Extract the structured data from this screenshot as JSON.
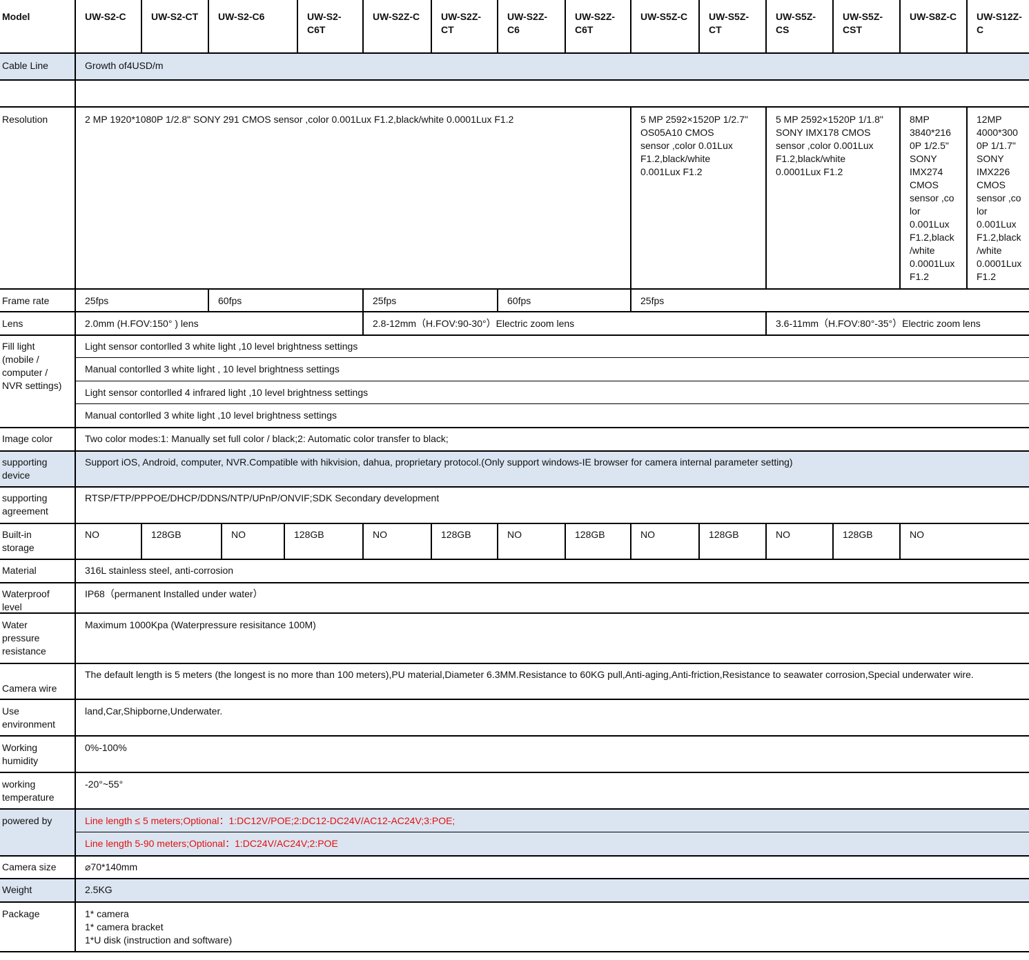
{
  "table": {
    "headers": [
      "Model",
      "UW-S2-C",
      "UW-S2-CT",
      "UW-S2-C6",
      "UW-S2-\nC6T",
      "UW-S2Z-C",
      "UW-S2Z-\nCT",
      "UW-S2Z-\nC6",
      "UW-S2Z-\nC6T",
      "UW-S5Z-C",
      "UW-S5Z-\nCT",
      "UW-S5Z-\nCS",
      "UW-S5Z-\nCST",
      "UW-S8Z-C",
      "UW-S12Z-\nC"
    ],
    "cable_line": {
      "label": "Cable Line",
      "value": "Growth of4USD/m"
    },
    "resolution": {
      "label": "Resolution",
      "s2": "2 MP 1920*1080P 1/2.8\" SONY 291 CMOS sensor ,color 0.001Lux F1.2,black/white 0.0001Lux F1.2",
      "s5_os": "5 MP 2592×1520P 1/2.7\"\nOS05A10 CMOS\nsensor ,color 0.01Lux\nF1.2,black/white\n0.001Lux F1.2",
      "s5_sony": "5 MP 2592×1520P 1/1.8\"\nSONY IMX178 CMOS\nsensor ,color 0.001Lux\nF1.2,black/white\n0.0001Lux F1.2",
      "s8": "8MP\n3840*216\n0P 1/2.5\"\nSONY\nIMX274\nCMOS\nsensor ,co\nlor\n0.001Lux\nF1.2,black\n/white\n0.0001Lux\nF1.2",
      "s12": "12MP\n4000*300\n0P  1/1.7\"\nSONY\nIMX226\nCMOS\nsensor ,co\nlor\n0.001Lux\nF1.2,black\n/white\n0.0001Lux\nF1.2"
    },
    "frame_rate": {
      "label": "Frame rate",
      "values": [
        "25fps",
        "60fps",
        "25fps",
        "60fps",
        "25fps"
      ]
    },
    "lens": {
      "label": "Lens",
      "values": [
        "2.0mm (H.FOV:150° ) lens",
        "2.8-12mm（H.FOV:90-30°）Electric zoom lens",
        "3.6-11mm（H.FOV:80°-35°）Electric zoom lens"
      ]
    },
    "fill_light": {
      "label": "Fill light\n(mobile /\ncomputer /\nNVR settings)",
      "values": [
        "Light  sensor contorlled  3 white light ,10 level brightness settings",
        "Manual contorlled 3 white light , 10 level brightness settings",
        "Light  sensor contorlled 4 infrared light ,10 level brightness  settings",
        "Manual contorlled 3 white light ,10 level  brightness settings"
      ]
    },
    "image_color": {
      "label": "Image color",
      "value": "Two color modes:1: Manually set full color / black;2: Automatic color transfer to black;"
    },
    "supporting_device": {
      "label": "supporting\ndevice",
      "value": "Support iOS, Android, computer, NVR.Compatible with hikvision, dahua, proprietary protocol.(Only support windows-IE browser for camera internal parameter setting)"
    },
    "supporting_agreement": {
      "label": "supporting\nagreement",
      "value": "RTSP/FTP/PPPOE/DHCP/DDNS/NTP/UPnP/ONVIF;SDK Secondary development"
    },
    "built_in_storage": {
      "label": "Built-in\nstorage",
      "values": [
        "NO",
        "128GB",
        "NO",
        "128GB",
        "NO",
        "128GB",
        "NO",
        "128GB",
        "NO",
        "128GB",
        "NO",
        "128GB",
        "NO"
      ]
    },
    "material": {
      "label": "Material",
      "value": "316L stainless steel, anti-corrosion"
    },
    "waterproof_level": {
      "label": "Waterproof\nlevel",
      "value": "IP68（permanent Installed under water）"
    },
    "water_pressure": {
      "label": "Water\npressure\nresistance",
      "value": "Maximum  1000Kpa  (Waterpressure resisitance  100M)"
    },
    "camera_wire": {
      "label": "Camera wire",
      "value": "The default length is 5 meters (the longest is no more than 100 meters),PU material,Diameter 6.3MM.Resistance to 60KG pull,Anti-aging,Anti-friction,Resistance to seawater corrosion,Special underwater wire."
    },
    "use_environment": {
      "label": "Use\nenvironment",
      "value": "land,Car,Shipborne,Underwater."
    },
    "working_humidity": {
      "label": "Working\nhumidity",
      "value": "0%-100%"
    },
    "working_temperature": {
      "label": "working\ntemperature",
      "value": "-20°~55°"
    },
    "powered_by": {
      "label": "powered by",
      "values": [
        "Line length ≤ 5 meters;Optional：1:DC12V/POE;2:DC12-DC24V/AC12-AC24V;3:POE;",
        "Line length 5-90 meters;Optional：1:DC24V/AC24V;2:POE"
      ]
    },
    "camera_size": {
      "label": "Camera size",
      "value": "⌀70*140mm"
    },
    "weight": {
      "label": "Weight",
      "value": "2.5KG"
    },
    "package": {
      "label": "Package",
      "value": "1* camera\n1* camera bracket\n1*U disk (instruction and software)"
    }
  },
  "colors": {
    "row_highlight": "#dbe5f1",
    "power_text": "#e01010",
    "grid": "#000000"
  }
}
